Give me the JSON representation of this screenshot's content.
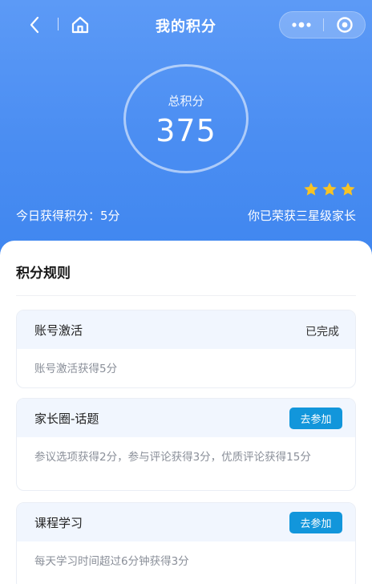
{
  "nav": {
    "title": "我的积分",
    "icons": {
      "back": "chevron-left-icon",
      "home": "home-icon",
      "more": "more-dots-icon",
      "close": "target-close-icon"
    }
  },
  "score": {
    "label": "总积分",
    "value": "375"
  },
  "today": {
    "text": "今日获得积分：5分"
  },
  "honor": {
    "text": "你已荣获三星级家长",
    "stars": 3,
    "star_color": "#f7c325"
  },
  "rules": {
    "title": "积分规则",
    "items": [
      {
        "name": "账号激活",
        "status": "已完成",
        "action": "",
        "desc": "账号激活获得5分"
      },
      {
        "name": "家长圈-话题",
        "status": "",
        "action": "去参加",
        "desc": "参议选项获得2分，参与评论获得3分，优质评论获得15分"
      },
      {
        "name": "课程学习",
        "status": "",
        "action": "去参加",
        "desc": "每天学习时间超过6分钟获得3分"
      }
    ]
  },
  "colors": {
    "header_blue": "#4a8df2",
    "button_blue": "#1296db"
  }
}
